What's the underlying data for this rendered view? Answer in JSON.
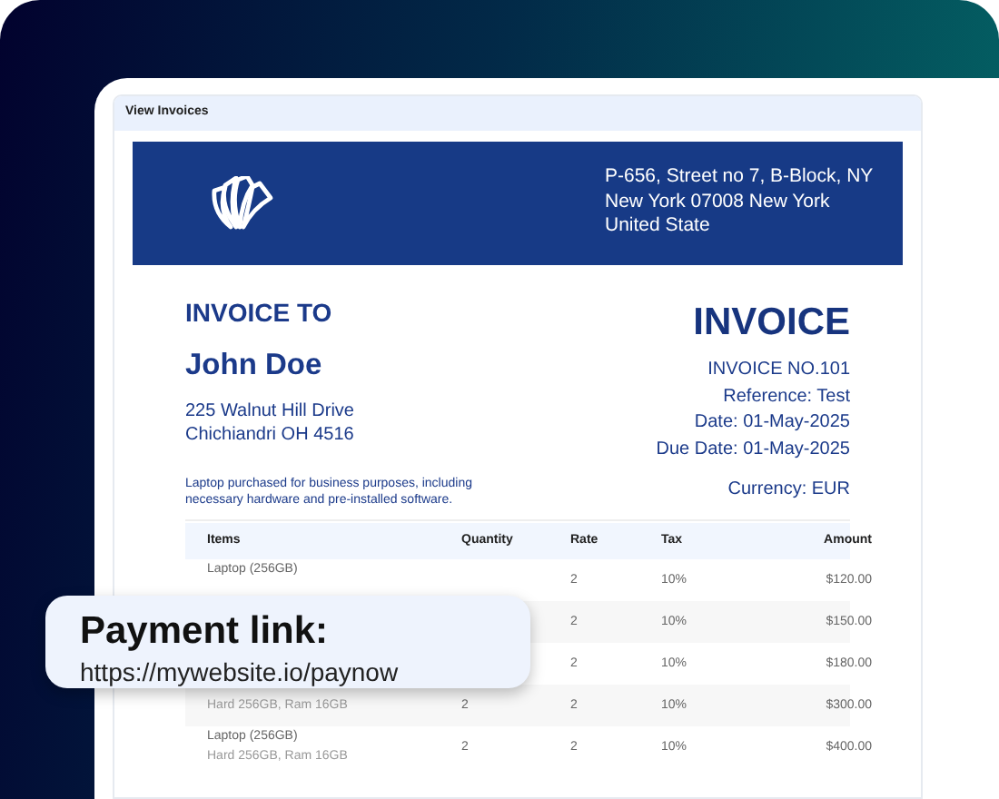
{
  "window": {
    "title": "View Invoices"
  },
  "company": {
    "address": "P-656, Street no 7, B-Block, NY New York 07008 New York United State"
  },
  "bill_to": {
    "heading": "INVOICE TO",
    "name": "John Doe",
    "address_lines": [
      "225 Walnut Hill Drive",
      "Chichiandri OH 4516"
    ],
    "description": "Laptop purchased for business purposes, including necessary hardware and pre-installed software."
  },
  "invoice": {
    "title": "INVOICE",
    "number": "INVOICE NO.101",
    "reference": "Reference: Test",
    "date": "Date: 01-May-2025",
    "due_date": "Due Date: 01-May-2025",
    "currency": "Currency: EUR"
  },
  "table": {
    "columns": [
      "Items",
      "Quantity",
      "Rate",
      "Tax",
      "Amount"
    ],
    "rows": [
      {
        "item": "Laptop (256GB)",
        "rate": "2",
        "tax": "10%",
        "amount": "$120.00"
      },
      {
        "rate": "2",
        "tax": "10%",
        "amount": "$150.00"
      },
      {
        "rate": "2",
        "tax": "10%",
        "amount": "$180.00"
      },
      {
        "detail": "Hard 256GB, Ram 16GB",
        "quantity": "2",
        "rate": "2",
        "tax": "10%",
        "amount": "$300.00"
      },
      {
        "item": "Laptop (256GB)",
        "detail": "Hard 256GB, Ram 16GB",
        "quantity": "2",
        "rate": "2",
        "tax": "10%",
        "amount": "$400.00"
      }
    ]
  },
  "callout": {
    "title": "Payment link:",
    "url": "https://mywebsite.io/paynow"
  }
}
